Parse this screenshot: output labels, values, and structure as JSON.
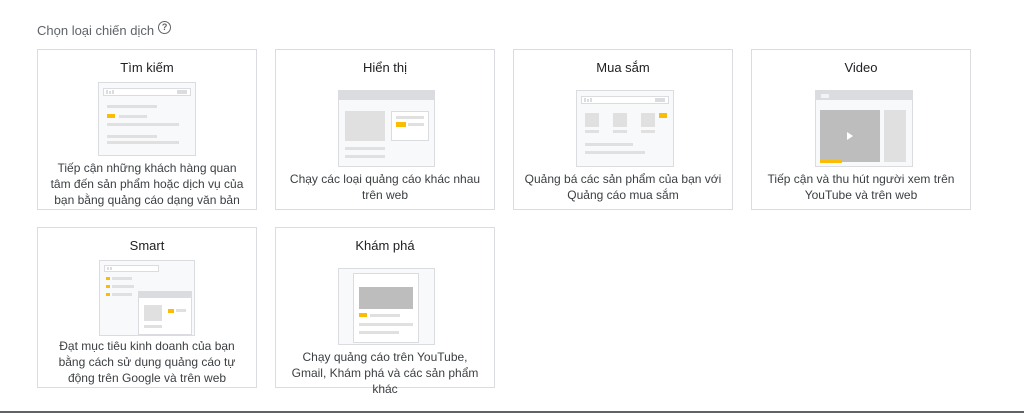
{
  "header": {
    "title": "Chọn loại chiến dịch",
    "help_icon": "help-circle-icon"
  },
  "cards": [
    {
      "id": "search",
      "title": "Tìm kiếm",
      "description": "Tiếp cận những khách hàng quan tâm đến sản phẩm hoặc dịch vụ của bạn bằng quảng cáo dạng văn bản"
    },
    {
      "id": "display",
      "title": "Hiển thị",
      "description": "Chạy các loại quảng cáo khác nhau trên web"
    },
    {
      "id": "shopping",
      "title": "Mua sắm",
      "description": "Quảng bá các sản phẩm của bạn với Quảng cáo mua sắm"
    },
    {
      "id": "video",
      "title": "Video",
      "description": "Tiếp cận và thu hút người xem trên YouTube và trên web"
    },
    {
      "id": "smart",
      "title": "Smart",
      "description": "Đạt mục tiêu kinh doanh của bạn bằng cách sử dụng quảng cáo tự động trên Google và trên web"
    },
    {
      "id": "discovery",
      "title": "Khám phá",
      "description": "Chạy quảng cáo trên YouTube, Gmail, Khám phá và các sản phẩm khác"
    }
  ],
  "colors": {
    "accent": "#fbbc04",
    "border": "#dadce0",
    "text": "#202124"
  }
}
